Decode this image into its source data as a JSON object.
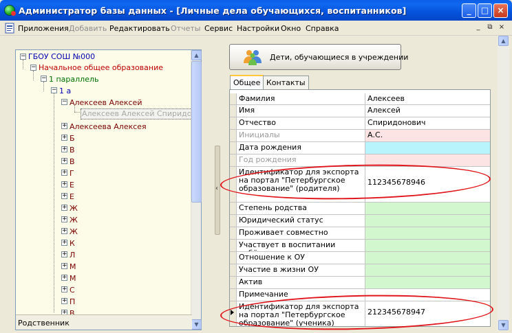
{
  "window": {
    "title": "Администратор базы данных - [Личные дела обучающихся, воспитанников]",
    "min": "_",
    "max": "□",
    "close": "×"
  },
  "menu": [
    {
      "label": "Приложения",
      "enabled": true
    },
    {
      "label": "Добавить",
      "enabled": false
    },
    {
      "label": "Редактировать",
      "enabled": true
    },
    {
      "label": "Отчеты",
      "enabled": false
    },
    {
      "label": "Сервис",
      "enabled": true
    },
    {
      "label": "Настройки",
      "enabled": true
    },
    {
      "label": "Окно",
      "enabled": true
    },
    {
      "label": "Справка",
      "enabled": true
    }
  ],
  "mdi": {
    "min": "_",
    "restore": "⧉",
    "close": "×"
  },
  "tree": {
    "root": "ГБОУ СОШ №000",
    "level": "Начальное общее образование",
    "parallel": "1 параллель",
    "class": "1 а",
    "student_open": "Алексеев Алексей",
    "relative": "Алексеев Алексей Спиридонович",
    "student2": "Алексеева Алексея",
    "items": [
      "Б",
      "В",
      "В",
      "Г",
      "Е",
      "Е",
      "Ж",
      "Ж",
      "Ж",
      "К",
      "Л",
      "М",
      "М",
      "С",
      "П",
      "В"
    ]
  },
  "left_footer": "Родственник",
  "big_button": "Дети, обучающиеся в учреждении",
  "tabs": [
    {
      "label": "Общее",
      "active": true
    },
    {
      "label": "Контакты",
      "active": false
    }
  ],
  "fields": [
    {
      "label": "Фамилия",
      "value": "Алексеев",
      "color": "#ffffff",
      "disabled": false
    },
    {
      "label": "Имя",
      "value": "Алексей",
      "color": "#ffffff",
      "disabled": false
    },
    {
      "label": "Отчество",
      "value": "Спиридонович",
      "color": "#ffffff",
      "disabled": false
    },
    {
      "label": "Инициалы",
      "value": "А.С.",
      "color": "#fde4e4",
      "disabled": true
    },
    {
      "label": "Дата рождения",
      "value": "",
      "color": "#b8f4fb",
      "disabled": false
    },
    {
      "label": "Год рождения",
      "value": "",
      "color": "#fde4e4",
      "disabled": true
    },
    {
      "label": "Идентификатор для экспорта на портал \"Петербургское образование\" (родителя)",
      "value": "112345678946",
      "color": "#ffffff",
      "disabled": false
    },
    {
      "label": "Степень родства",
      "value": "",
      "color": "#d2f6cd",
      "disabled": false
    },
    {
      "label": "Юридический статус",
      "value": "",
      "color": "#d2f6cd",
      "disabled": false
    },
    {
      "label": "Проживает совместно",
      "value": "",
      "color": "#d2f6cd",
      "disabled": false
    },
    {
      "label": "Участвует в воспитании ребёнка",
      "value": "",
      "color": "#d2f6cd",
      "disabled": false
    },
    {
      "label": "Отношение к ОУ",
      "value": "",
      "color": "#d2f6cd",
      "disabled": false
    },
    {
      "label": "Участие в жизни ОУ",
      "value": "",
      "color": "#d2f6cd",
      "disabled": false
    },
    {
      "label": "Актив",
      "value": "",
      "color": "#d2f6cd",
      "disabled": false
    },
    {
      "label": "Примечание",
      "value": "",
      "color": "#ffffff",
      "disabled": false
    },
    {
      "label": "Идентификатор для экспорта на портал \"Петербургское образование\" (ученика)",
      "value": "212345678947",
      "color": "#ffffff",
      "disabled": false
    }
  ],
  "colors": {
    "root": "#0000b0",
    "level": "#c00000",
    "parallel": "#007000",
    "class": "#0000b0",
    "student": "#7a0000",
    "highlight": "#e0151b"
  }
}
